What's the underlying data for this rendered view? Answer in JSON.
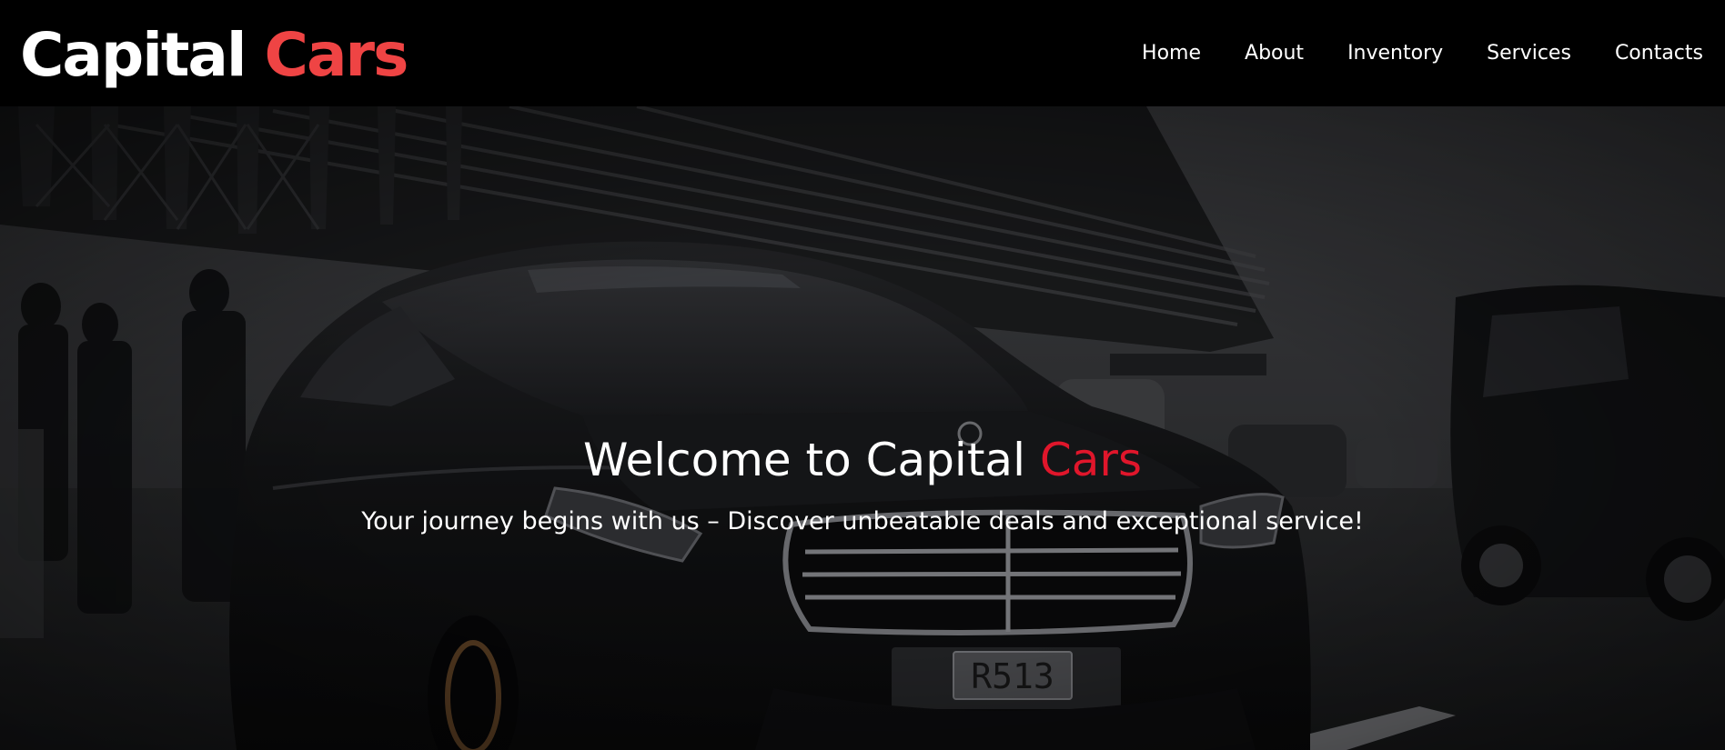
{
  "brand": {
    "name_part1": "Capital",
    "name_part2": "Cars",
    "accent_color": "#ef4444"
  },
  "nav": {
    "items": [
      {
        "label": "Home"
      },
      {
        "label": "About"
      },
      {
        "label": "Inventory"
      },
      {
        "label": "Services"
      },
      {
        "label": "Contacts"
      }
    ]
  },
  "hero": {
    "title_part1": "Welcome to Capital",
    "title_part2": "Cars",
    "title_accent_color": "#e0162b",
    "subtitle": "Your journey begins with us – Discover unbeatable deals and exceptional service!",
    "background": "dark photo of black luxury sedan at airport terminal",
    "plate": "R513"
  }
}
